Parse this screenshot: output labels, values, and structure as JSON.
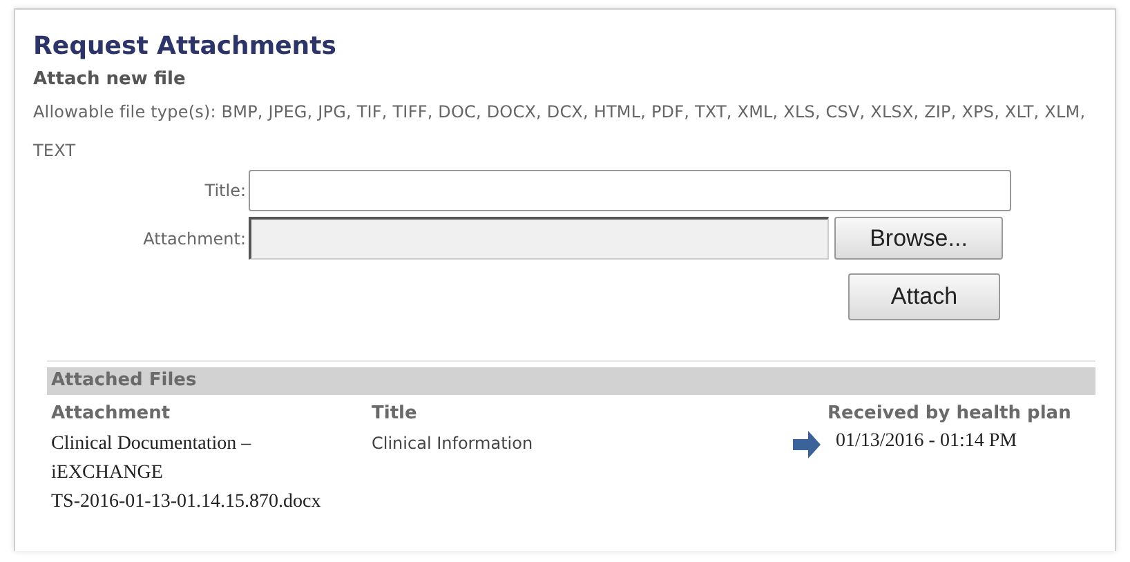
{
  "heading": "Request Attachments",
  "subheading": "Attach new file",
  "allowed_types": "Allowable file type(s): BMP, JPEG, JPG, TIF, TIFF, DOC, DOCX, DCX, HTML, PDF, TXT, XML, XLS, CSV, XLSX, ZIP, XPS, XLT, XLM, TEXT",
  "form": {
    "title_label": "Title:",
    "attachment_label": "Attachment:",
    "browse_button": "Browse...",
    "attach_button": "Attach"
  },
  "attached_files": {
    "title": "Attached Files",
    "columns": [
      "Attachment",
      "Title",
      "Received by health plan"
    ],
    "rows": [
      {
        "attachment": "Clinical Documentation –\niEXCHANGE\nTS-2016-01-13-01.14.15.870.docx",
        "title": "Clinical Information",
        "received": "01/13/2016 - 01:14 PM"
      }
    ]
  }
}
